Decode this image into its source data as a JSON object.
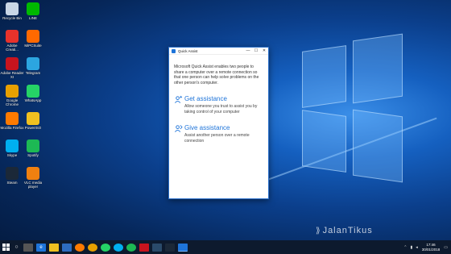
{
  "desktop_icons": [
    {
      "label": "Recycle Bin",
      "icon": "recycle-bin-icon",
      "color": "#c9d6e6"
    },
    {
      "label": "LINE",
      "icon": "line-icon",
      "color": "#00b900"
    },
    {
      "label": "Adobe Creati...",
      "icon": "adobe-creative-cloud-icon",
      "color": "#e8322b"
    },
    {
      "label": "MiPCSuite",
      "icon": "mi-pc-suite-icon",
      "color": "#ff6900"
    },
    {
      "label": "Adobe Reader XI",
      "icon": "adobe-reader-icon",
      "color": "#c8141e"
    },
    {
      "label": "Telegram",
      "icon": "telegram-icon",
      "color": "#2ca5e0"
    },
    {
      "label": "Google Chrome",
      "icon": "chrome-icon",
      "color": "#e8a000"
    },
    {
      "label": "WhatsApp",
      "icon": "whatsapp-icon",
      "color": "#25d366"
    },
    {
      "label": "Mozilla Firefox",
      "icon": "firefox-icon",
      "color": "#ff7a00"
    },
    {
      "label": "PowerISO",
      "icon": "poweriso-icon",
      "color": "#f0c020"
    },
    {
      "label": "Skype",
      "icon": "skype-icon",
      "color": "#00aff0"
    },
    {
      "label": "Spotify",
      "icon": "spotify-icon",
      "color": "#1db954"
    },
    {
      "label": "Steam",
      "icon": "steam-icon",
      "color": "#1b2838"
    },
    {
      "label": "VLC media player",
      "icon": "vlc-icon",
      "color": "#f08010"
    }
  ],
  "window": {
    "title": "Quick Assist",
    "intro": "Microsoft Quick Assist enables two people to share a computer over a remote connection so that one person can help solve problems on the other person's computer.",
    "get": {
      "heading": "Get assistance",
      "desc": "Allow someone you trust to assist you by taking control of your computer"
    },
    "give": {
      "heading": "Give assistance",
      "desc": "Assist another person over a remote connection"
    }
  },
  "taskbar": {
    "clock_time": "17:46",
    "clock_date": "30/01/2018"
  },
  "watermark": "JalanTikus",
  "accent": "#1e74d9"
}
